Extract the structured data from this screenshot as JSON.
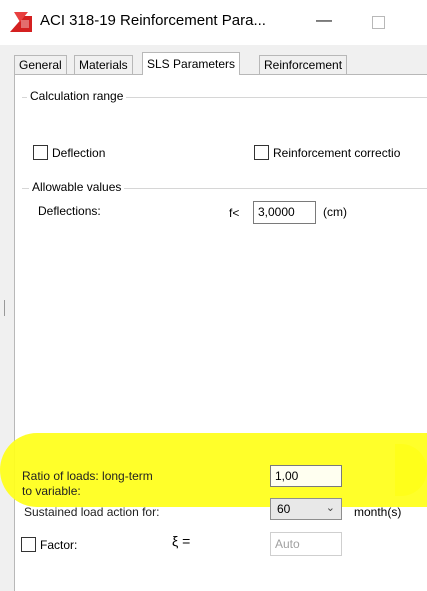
{
  "window": {
    "title": "ACI 318-19 Reinforcement Para...",
    "minimize_glyph": "—",
    "icon": "app-red-logo-icon"
  },
  "tabs": [
    {
      "label": "General"
    },
    {
      "label": "Materials"
    },
    {
      "label": "SLS Parameters"
    },
    {
      "label": "Reinforcement"
    }
  ],
  "calculation_range": {
    "label": "Calculation range",
    "deflection_label": "Deflection",
    "reinforcement_correction_label": "Reinforcement correctio"
  },
  "allowable_values": {
    "label": "Allowable values",
    "deflections_label": "Deflections:",
    "f_label": "f<",
    "f_value": "3,0000",
    "unit": "(cm)"
  },
  "loads": {
    "ratio_label_line1": "Ratio of loads: long-term",
    "ratio_label_line2": "to variable:",
    "ratio_value": "1,00",
    "sustained_label": "Sustained load action for:",
    "sustained_value": "60",
    "sustained_unit": "month(s)",
    "factor_label": "Factor:",
    "xi_symbol": "ξ =",
    "factor_value": "Auto"
  },
  "colors": {
    "highlight": "#ffff1a",
    "accent_red": "#d42020"
  }
}
